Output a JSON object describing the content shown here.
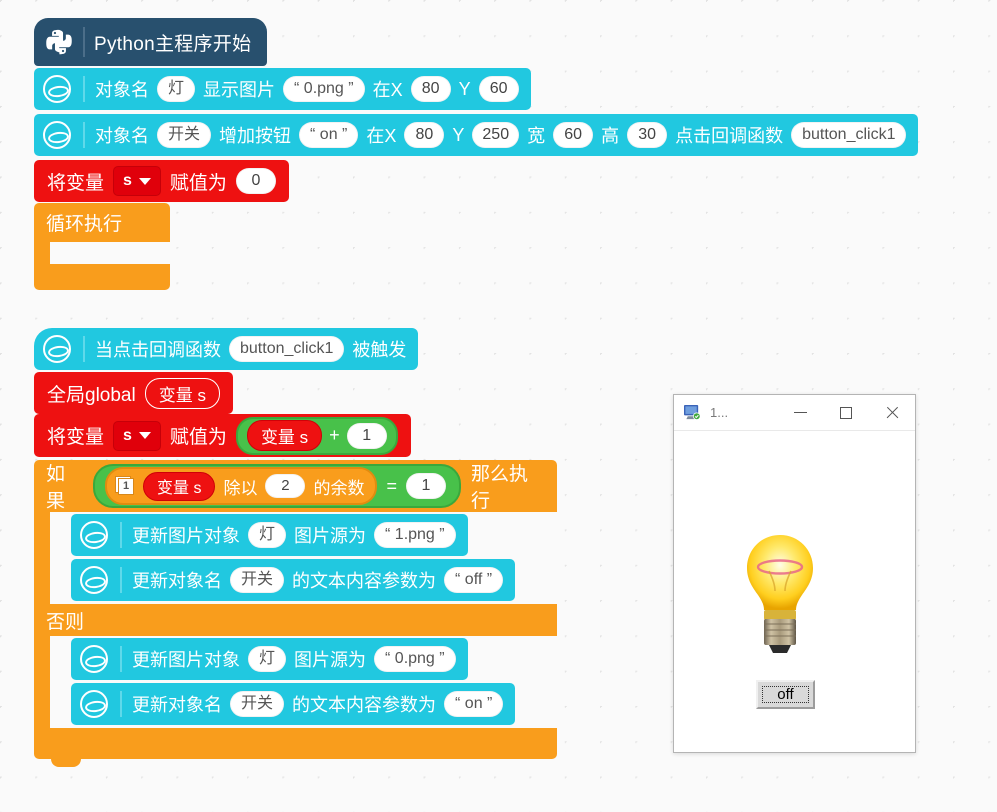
{
  "workspace": {
    "background_color": "#fafafa",
    "grid_dot_color": "#e2e2e2"
  },
  "colors": {
    "hat_block": "#28506e",
    "command_block": "#21c8e0",
    "variable_block": "#ee1111",
    "control_block": "#f99d1c",
    "operator_block": "#48c14a"
  },
  "stack_main": {
    "hat": {
      "icon": "python-logo-icon",
      "label": "Python主程序开始"
    },
    "blocks": [
      {
        "icon": "gui-object-icon",
        "parts": [
          {
            "type": "text",
            "value": "对象名"
          },
          {
            "type": "field",
            "value": "灯"
          },
          {
            "type": "text",
            "value": "显示图片"
          },
          {
            "type": "field",
            "value": "“ 0.png ”"
          },
          {
            "type": "text",
            "value": "在X"
          },
          {
            "type": "num",
            "value": "80"
          },
          {
            "type": "text",
            "value": "Y"
          },
          {
            "type": "num",
            "value": "60"
          }
        ]
      },
      {
        "icon": "gui-object-icon",
        "parts": [
          {
            "type": "text",
            "value": "对象名"
          },
          {
            "type": "field",
            "value": "开关"
          },
          {
            "type": "text",
            "value": "增加按钮"
          },
          {
            "type": "field",
            "value": "“ on ”"
          },
          {
            "type": "text",
            "value": "在X"
          },
          {
            "type": "num",
            "value": "80"
          },
          {
            "type": "text",
            "value": "Y"
          },
          {
            "type": "num",
            "value": "250"
          },
          {
            "type": "text",
            "value": "宽"
          },
          {
            "type": "num",
            "value": "60"
          },
          {
            "type": "text",
            "value": "高"
          },
          {
            "type": "num",
            "value": "30"
          },
          {
            "type": "text",
            "value": "点击回调函数"
          },
          {
            "type": "field",
            "value": "button_click1"
          }
        ]
      }
    ],
    "set_variable": {
      "prefix": "将变量",
      "variable": "s",
      "middle": "赋值为",
      "value": "0"
    },
    "loop": {
      "label": "循环执行"
    }
  },
  "stack_callback": {
    "hat": {
      "icon": "gui-object-icon",
      "prefix": "当点击回调函数",
      "function": "button_click1",
      "suffix": "被触发"
    },
    "global_decl": {
      "prefix": "全局global",
      "pill": "变量 s"
    },
    "set_variable": {
      "prefix": "将变量",
      "variable": "s",
      "middle": "赋值为",
      "operand_left": "变量 s",
      "operator": "+",
      "operand_right": "1"
    },
    "if_block": {
      "if_label": "如果",
      "then_label": "那么执行",
      "else_label": "否则",
      "condition": {
        "badge": "1",
        "left_var": "变量 s",
        "mod_text": "除以",
        "mod_value": "2",
        "mod_suffix": "的余数",
        "comparator": "=",
        "right_value": "1"
      },
      "then_blocks": [
        {
          "icon": "gui-object-icon",
          "parts": [
            {
              "type": "text",
              "value": "更新图片对象"
            },
            {
              "type": "field",
              "value": "灯"
            },
            {
              "type": "text",
              "value": "图片源为"
            },
            {
              "type": "field",
              "value": "“ 1.png ”"
            }
          ]
        },
        {
          "icon": "gui-object-icon",
          "parts": [
            {
              "type": "text",
              "value": "更新对象名"
            },
            {
              "type": "field",
              "value": "开关"
            },
            {
              "type": "text",
              "value": "的文本内容参数为"
            },
            {
              "type": "field",
              "value": "“ off ”"
            }
          ]
        }
      ],
      "else_blocks": [
        {
          "icon": "gui-object-icon",
          "parts": [
            {
              "type": "text",
              "value": "更新图片对象"
            },
            {
              "type": "field",
              "value": "灯"
            },
            {
              "type": "text",
              "value": "图片源为"
            },
            {
              "type": "field",
              "value": "“ 0.png ”"
            }
          ]
        },
        {
          "icon": "gui-object-icon",
          "parts": [
            {
              "type": "text",
              "value": "更新对象名"
            },
            {
              "type": "field",
              "value": "开关"
            },
            {
              "type": "text",
              "value": "的文本内容参数为"
            },
            {
              "type": "field",
              "value": "“ on ”"
            }
          ]
        }
      ]
    }
  },
  "app_window": {
    "icon": "monitor-app-icon",
    "title": "1...",
    "minimize_label": "minimize-icon",
    "maximize_label": "maximize-icon",
    "close_label": "close-icon",
    "image": "lightbulb-on-image",
    "button_label": "off"
  }
}
